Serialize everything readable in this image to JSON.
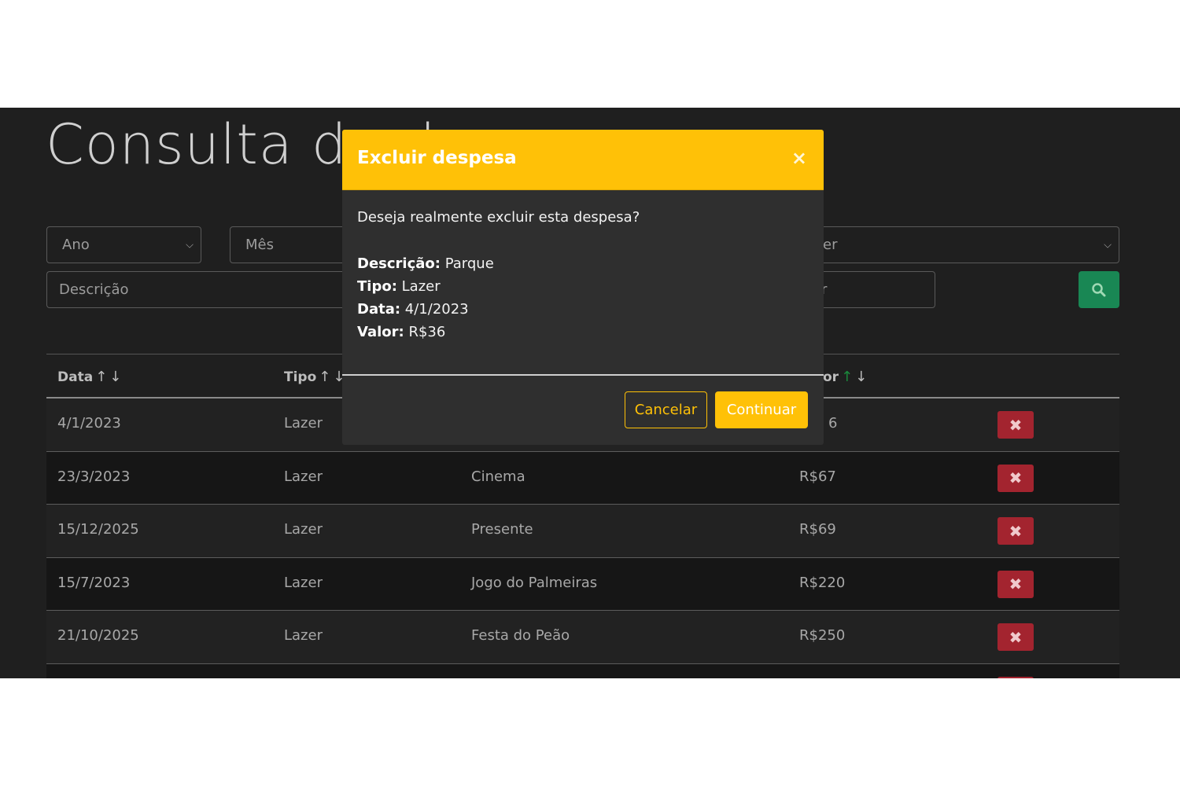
{
  "page": {
    "title": "Consulta de d"
  },
  "filters": {
    "year_label": "Ano",
    "month_label": "Mês",
    "type_label": "er",
    "description_placeholder": "Descrição",
    "value_placeholder": "r"
  },
  "table": {
    "headers": {
      "date": "Data",
      "type": "Tipo",
      "value": "or"
    },
    "first_row_value_partial": "6",
    "rows": [
      {
        "date": "4/1/2023",
        "type": "Lazer",
        "description": "",
        "value": ""
      },
      {
        "date": "23/3/2023",
        "type": "Lazer",
        "description": "Cinema",
        "value": "R$67"
      },
      {
        "date": "15/12/2025",
        "type": "Lazer",
        "description": "Presente",
        "value": "R$69"
      },
      {
        "date": "15/7/2023",
        "type": "Lazer",
        "description": "Jogo do Palmeiras",
        "value": "R$220"
      },
      {
        "date": "21/10/2025",
        "type": "Lazer",
        "description": "Festa do Peão",
        "value": "R$250"
      }
    ]
  },
  "modal": {
    "title": "Excluir despesa",
    "close_symbol": "×",
    "question": "Deseja realmente excluir esta despesa?",
    "description_label": "Descrição:",
    "description_value": "Parque",
    "type_label": "Tipo:",
    "type_value": "Lazer",
    "date_label": "Data:",
    "date_value": "4/1/2023",
    "value_label": "Valor:",
    "value_value": "R$36",
    "cancel_label": "Cancelar",
    "continue_label": "Continuar"
  },
  "colors": {
    "warning": "#ffc107",
    "success": "#198754",
    "danger": "#a3242f",
    "background": "#1f1f1f"
  },
  "icons": {
    "search": "search-icon",
    "delete": "x-icon",
    "sort": "sort-arrows-icon"
  }
}
